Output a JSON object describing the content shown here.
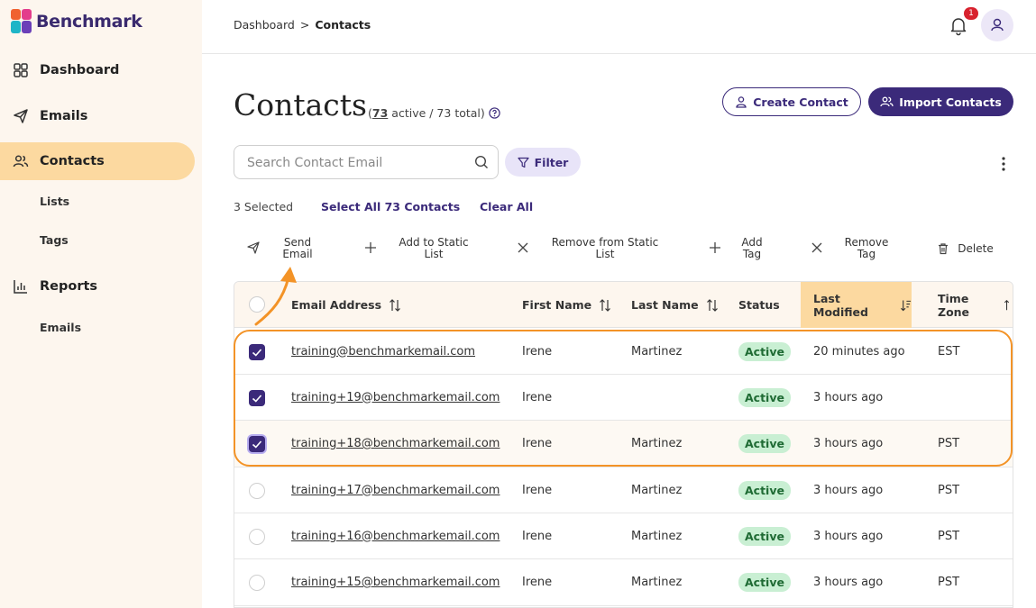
{
  "brand": {
    "name": "Benchmark"
  },
  "sidebar": {
    "items": [
      {
        "label": "Dashboard",
        "icon": "grid-icon"
      },
      {
        "label": "Emails",
        "icon": "send-icon"
      },
      {
        "label": "Contacts",
        "icon": "users-icon",
        "active": true
      },
      {
        "label": "Reports",
        "icon": "bar-chart-icon"
      }
    ],
    "contacts_sub": [
      "Lists",
      "Tags"
    ],
    "reports_sub": [
      "Emails"
    ]
  },
  "breadcrumb": {
    "root": "Dashboard",
    "separator": ">",
    "current": "Contacts"
  },
  "notifications": {
    "count": "1"
  },
  "page": {
    "title": "Contacts",
    "count_open": "(",
    "active_count": "73",
    "active_label": "active / 73 total)",
    "create_contact": "Create Contact",
    "import_contacts": "Import Contacts"
  },
  "search": {
    "placeholder": "Search Contact Email"
  },
  "filter": {
    "label": "Filter"
  },
  "selection": {
    "selected_text": "3 Selected",
    "select_all": "Select All 73 Contacts",
    "clear_all": "Clear All"
  },
  "actions": {
    "send_email": [
      "Send",
      "Email"
    ],
    "add_static": [
      "Add to Static",
      "List"
    ],
    "remove_static": [
      "Remove from Static",
      "List"
    ],
    "add_tag": [
      "Add",
      "Tag"
    ],
    "remove_tag": [
      "Remove",
      "Tag"
    ],
    "delete": "Delete"
  },
  "table": {
    "columns": [
      "Email Address",
      "First Name",
      "Last Name",
      "Status",
      "Last Modified",
      "Time Zone"
    ],
    "rows": [
      {
        "email": "training@benchmarkemail.com",
        "first": "Irene",
        "last": "Martinez",
        "status": "Active",
        "modified": "20 minutes ago",
        "tz": "EST",
        "checked": true
      },
      {
        "email": "training+19@benchmarkemail.com",
        "first": "Irene",
        "last": "",
        "status": "Active",
        "modified": "3 hours ago",
        "tz": "",
        "checked": true
      },
      {
        "email": "training+18@benchmarkemail.com",
        "first": "Irene",
        "last": "Martinez",
        "status": "Active",
        "modified": "3 hours ago",
        "tz": "PST",
        "checked": true
      },
      {
        "email": "training+17@benchmarkemail.com",
        "first": "Irene",
        "last": "Martinez",
        "status": "Active",
        "modified": "3 hours ago",
        "tz": "PST",
        "checked": false
      },
      {
        "email": "training+16@benchmarkemail.com",
        "first": "Irene",
        "last": "Martinez",
        "status": "Active",
        "modified": "3 hours ago",
        "tz": "PST",
        "checked": false
      },
      {
        "email": "training+15@benchmarkemail.com",
        "first": "Irene",
        "last": "Martinez",
        "status": "Active",
        "modified": "3 hours ago",
        "tz": "PST",
        "checked": false
      }
    ]
  },
  "colors": {
    "brand_primary": "#3b2a7a",
    "sidebar_active": "#fcd9a0",
    "status_active_bg": "#c9efd3",
    "highlight": "#f39327"
  }
}
